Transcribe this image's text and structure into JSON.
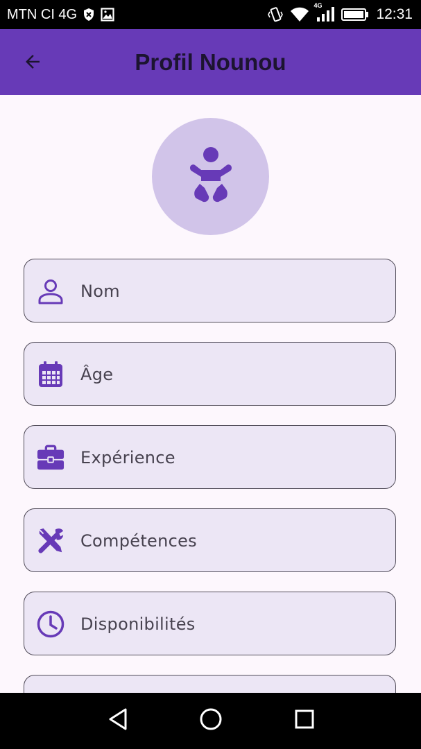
{
  "status_bar": {
    "carrier": "MTN CI 4G",
    "network_badge": "4G",
    "time": "12:31",
    "icons": [
      "shield-x-icon",
      "image-icon",
      "vibrate-icon",
      "wifi-icon",
      "signal-icon",
      "battery-icon"
    ]
  },
  "app_bar": {
    "title": "Profil Nounou",
    "back_icon": "arrow-left-icon",
    "color": "#673ab7"
  },
  "avatar": {
    "icon": "baby-icon",
    "background": "#d1c4e9",
    "icon_color": "#673ab7"
  },
  "fields": [
    {
      "label": "Nom",
      "icon": "person-icon"
    },
    {
      "label": "Âge",
      "icon": "calendar-icon"
    },
    {
      "label": "Expérience",
      "icon": "briefcase-icon"
    },
    {
      "label": "Compétences",
      "icon": "tools-icon"
    },
    {
      "label": "Disponibilités",
      "icon": "clock-icon"
    }
  ],
  "nav_bar": {
    "buttons": [
      "back-triangle-icon",
      "home-circle-icon",
      "recents-square-icon"
    ]
  },
  "colors": {
    "accent": "#673ab7",
    "background": "#fdf7fd",
    "field_fill": "#ece6f5",
    "field_border": "#4f4a57"
  }
}
